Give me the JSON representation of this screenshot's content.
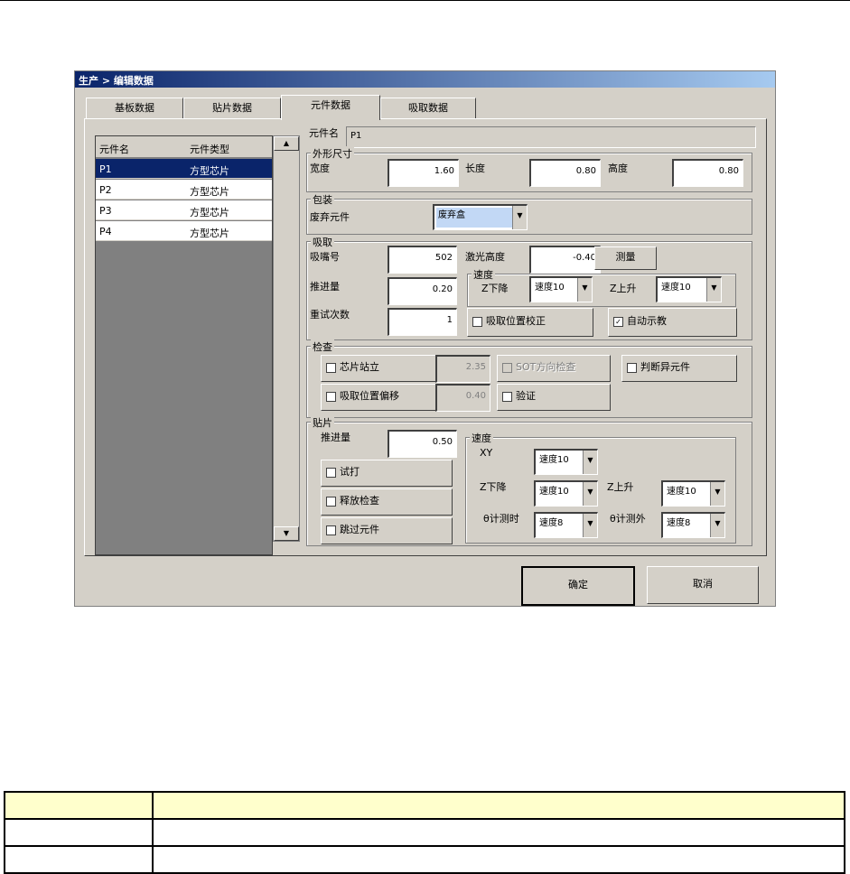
{
  "window": {
    "title": "生产 > 编辑数据"
  },
  "tabs": [
    {
      "label": "基板数据"
    },
    {
      "label": "贴片数据"
    },
    {
      "label": "元件数据",
      "active": true
    },
    {
      "label": "吸取数据"
    }
  ],
  "list": {
    "headers": [
      "元件名",
      "元件类型"
    ],
    "rows": [
      {
        "name": "P1",
        "type": "方型芯片",
        "selected": true
      },
      {
        "name": "P2",
        "type": "方型芯片"
      },
      {
        "name": "P3",
        "type": "方型芯片"
      },
      {
        "name": "P4",
        "type": "方型芯片"
      }
    ]
  },
  "component": {
    "label": "元件名",
    "value": "P1"
  },
  "shape": {
    "title": "外形尺寸",
    "width_label": "宽度",
    "width": "1.60",
    "length_label": "长度",
    "length": "0.80",
    "height_label": "高度",
    "height": "0.80"
  },
  "package": {
    "title": "包装",
    "discard_label": "废弃元件",
    "discard_value": "废弃盒"
  },
  "pickup": {
    "title": "吸取",
    "nozzle_label": "吸嘴号",
    "nozzle": "502",
    "laser_label": "激光高度",
    "laser": "-0.40",
    "measure_btn": "测量",
    "push_label": "推进量",
    "push": "0.20",
    "retry_label": "重试次数",
    "retry": "1",
    "speed_title": "速度",
    "zdown_label": "Z下降",
    "zdown": "速度10",
    "zup_label": "Z上升",
    "zup": "速度10",
    "pos_correction": "吸取位置校正",
    "auto_teach": "自动示教"
  },
  "inspect": {
    "title": "检查",
    "chip_stand": "芯片站立",
    "chip_stand_value": "2.35",
    "sot_check": "SOT方向检查",
    "judge_abnormal": "判断异元件",
    "pickup_offset": "吸取位置偏移",
    "pickup_offset_value": "0.40",
    "verify": "验证"
  },
  "mount": {
    "title": "贴片",
    "push_label": "推进量",
    "push": "0.50",
    "test_print": "试打",
    "release_check": "释放检查",
    "skip_component": "跳过元件",
    "speed_title": "速度",
    "xy_label": "XY",
    "xy": "速度10",
    "zdown_label": "Z下降",
    "zdown": "速度10",
    "zup_label": "Z上升",
    "zup": "速度10",
    "theta_measure_label": "θ计测时",
    "theta_measure": "速度8",
    "theta_other_label": "θ计测外",
    "theta_other": "速度8"
  },
  "buttons": {
    "ok": "确定",
    "cancel": "取消"
  },
  "colors": {
    "titlebar": "#0a246a",
    "dialog_bg": "#d4d0c8",
    "selection": "#0a246a",
    "table_header": "#ffffcc"
  }
}
